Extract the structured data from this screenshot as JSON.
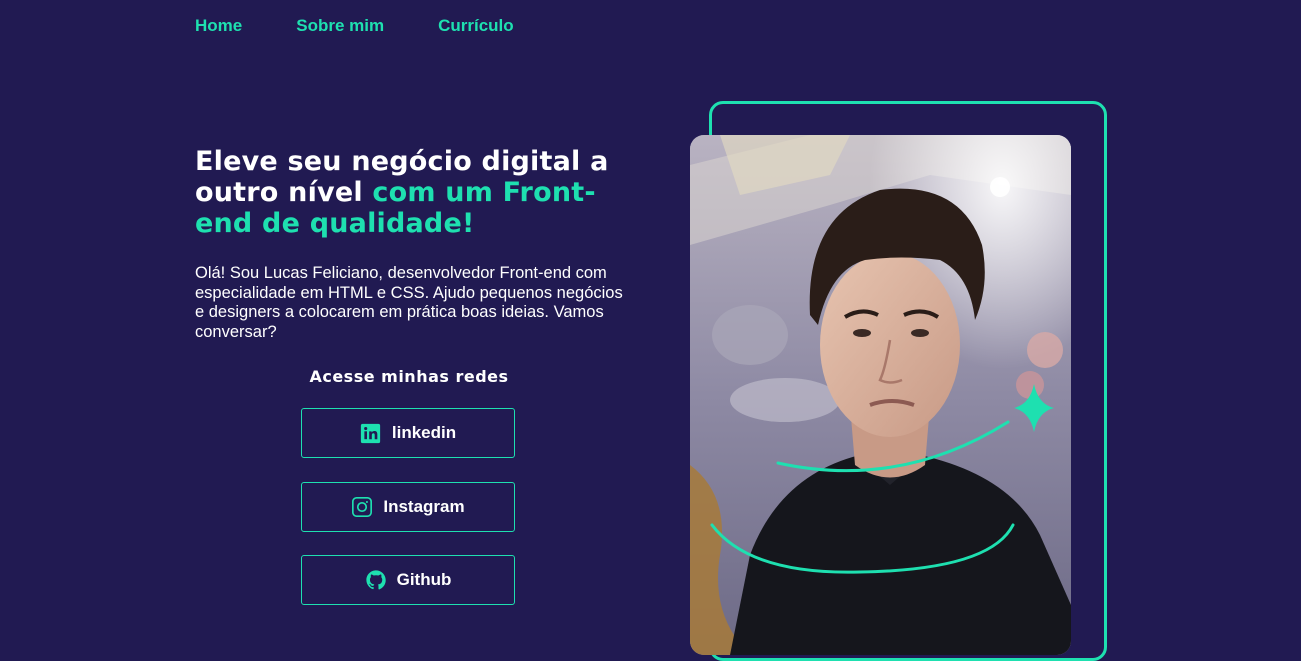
{
  "nav": {
    "home": "Home",
    "about": "Sobre mim",
    "resume": "Currículo"
  },
  "hero": {
    "headline_part1": "Eleve seu negócio digital a outro nível ",
    "headline_accent": "com um Front-end de qualidade!",
    "intro": "Olá! Sou Lucas Feliciano, desenvolvedor Front-end com especialidade em HTML e CSS. Ajudo pequenos negócios e designers a colocarem em prática boas ideias. Vamos conversar?"
  },
  "networks": {
    "title": "Acesse minhas redes",
    "items": [
      {
        "label": "linkedin",
        "icon": "linkedin-icon"
      },
      {
        "label": "Instagram",
        "icon": "instagram-icon"
      },
      {
        "label": "Github",
        "icon": "github-icon"
      }
    ]
  },
  "colors": {
    "background": "#211a52",
    "accent": "#1ee0b0",
    "text": "#ffffff"
  },
  "decorations": {
    "sparkle": "sparkle-icon"
  }
}
